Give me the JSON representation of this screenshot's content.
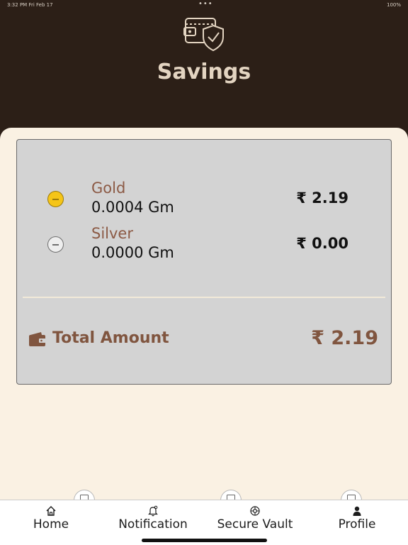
{
  "status_bar": {
    "time": "3:32 PM   Fri Feb 17",
    "center": "•••",
    "right": "100%"
  },
  "header": {
    "icon": "wallet-shield-icon",
    "title": "Savings"
  },
  "holdings": [
    {
      "name": "Gold",
      "weight": "0.0004 Gm",
      "amount": "₹ 2.19",
      "icon": "gold-coin-icon"
    },
    {
      "name": "Silver",
      "weight": "0.0000 Gm",
      "amount": "₹ 0.00",
      "icon": "silver-coin-icon"
    }
  ],
  "total": {
    "icon": "wallet-icon",
    "label": "Total Amount",
    "amount": "₹ 2.19"
  },
  "tabs": [
    {
      "label": "Home",
      "icon": "home-icon"
    },
    {
      "label": "Notification",
      "icon": "bell-icon"
    },
    {
      "label": "Secure Vault",
      "icon": "vault-icon"
    },
    {
      "label": "Profile",
      "icon": "person-icon"
    }
  ],
  "colors": {
    "header_bg": "#2c1f17",
    "page_bg": "#faf1e3",
    "card_bg": "#d3d3d3",
    "accent_brown": "#8c5a45",
    "gold": "#f5c518"
  }
}
